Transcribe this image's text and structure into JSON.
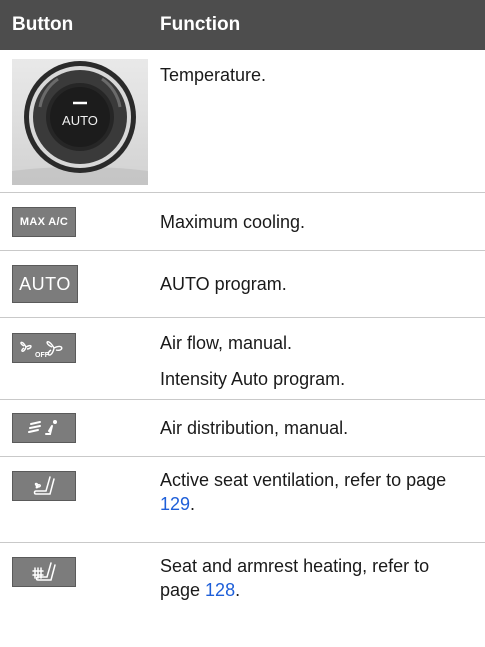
{
  "header": {
    "col1": "Button",
    "col2": "Function"
  },
  "rows": [
    {
      "icon": "temperature-knob-icon",
      "knob_label": "AUTO",
      "text": "Temperature."
    },
    {
      "icon": "max-ac-button",
      "button_label": "MAX A/C",
      "text": "Maximum cooling."
    },
    {
      "icon": "auto-button",
      "button_label": "AUTO",
      "text": "AUTO program."
    },
    {
      "icon": "fan-off-fan-icon",
      "fan_off_label": "OFF",
      "text": "Air flow, manual.",
      "text2": "Intensity Auto program."
    },
    {
      "icon": "air-distribution-icon",
      "text": "Air distribution, manual."
    },
    {
      "icon": "seat-ventilation-icon",
      "text_before": "Active seat ventilation, refer to page ",
      "link": "129",
      "text_after": "."
    },
    {
      "icon": "seat-heating-icon",
      "text_before": "Seat and armrest heating, refer to page ",
      "link": "128",
      "text_after": "."
    }
  ],
  "colors": {
    "header_bg": "#4d4d4d",
    "button_bg": "#7c7c7c",
    "link": "#1e5fd9"
  }
}
